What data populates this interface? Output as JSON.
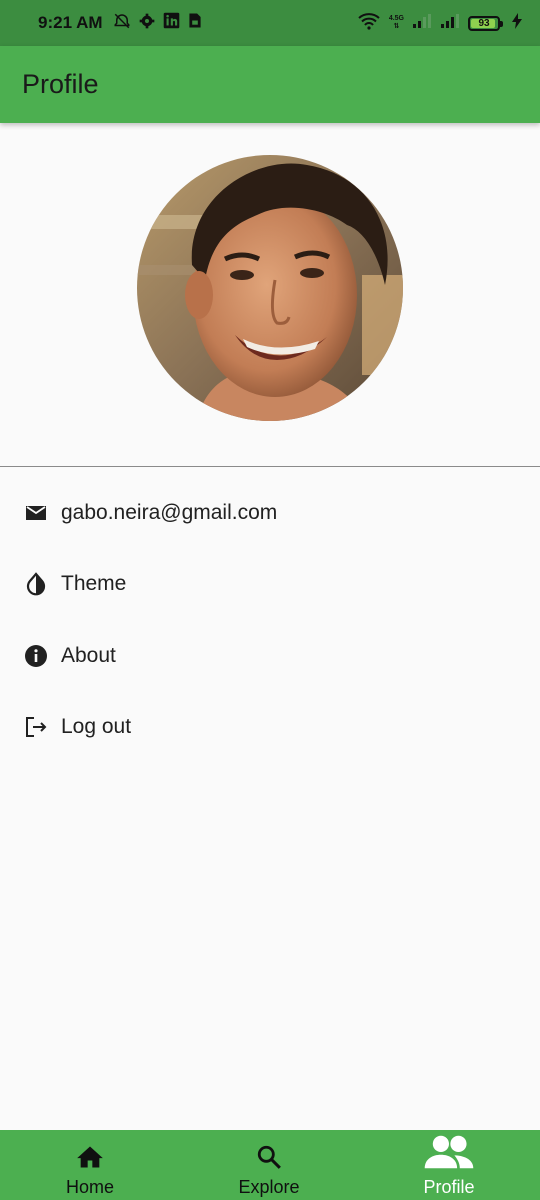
{
  "status_bar": {
    "time": "9:21 AM",
    "network_top": "4.5G",
    "network_bottom": "⇅",
    "battery": "93"
  },
  "app_bar": {
    "title": "Profile"
  },
  "profile": {
    "avatar_alt": "user-photo",
    "items": [
      {
        "label": "gabo.neira@gmail.com",
        "icon": "mail-icon"
      },
      {
        "label": "Theme",
        "icon": "contrast-icon"
      },
      {
        "label": "About",
        "icon": "info-icon"
      },
      {
        "label": "Log out",
        "icon": "logout-icon"
      }
    ]
  },
  "bottom_nav": {
    "items": [
      {
        "label": "Home",
        "icon": "home-icon"
      },
      {
        "label": "Explore",
        "icon": "search-icon"
      },
      {
        "label": "Profile",
        "icon": "people-icon",
        "active": true
      }
    ]
  },
  "colors": {
    "primary": "#4caf50",
    "status_bar": "#3c8d40",
    "background": "#fafafa",
    "active_nav": "#ffffff"
  }
}
